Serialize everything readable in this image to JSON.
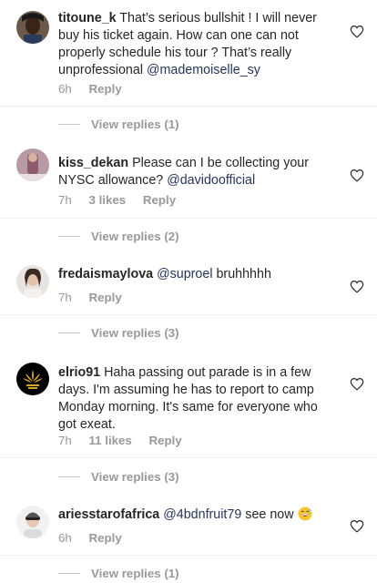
{
  "colors": {
    "text": "#262626",
    "meta": "#999999",
    "mention": "#27355a",
    "divider": "#efefef"
  },
  "icons": {
    "like": "heart-outline-icon",
    "emoji": "grinning-sweat-emoji"
  },
  "comments": [
    {
      "username": "titoune_k",
      "text": "That’s serious bullshit ! I will never buy his ticket again. How can one can not properly schedule his tour ? That’s really unprofessional",
      "mention": "@mademoiselle_sy",
      "time": "6h",
      "likes": "",
      "reply_label": "Reply",
      "view_replies": "View replies (1)"
    },
    {
      "username": "kiss_dekan",
      "text": "Please can I be collecting your NYSC allowance?",
      "mention": "@davidoofficial",
      "time": "7h",
      "likes": "3 likes",
      "reply_label": "Reply",
      "view_replies": "View replies (2)"
    },
    {
      "username": "fredaismaylova",
      "mention": "@suproel",
      "text": "bruhhhhh",
      "time": "7h",
      "likes": "",
      "reply_label": "Reply",
      "view_replies": "View replies (3)"
    },
    {
      "username": "elrio91",
      "text": "Haha passing out parade is in a few days. I'm assuming he has to report to camp Monday morning. It's same for everyone who got exeat.",
      "time": "7h",
      "likes": "11 likes",
      "reply_label": "Reply",
      "view_replies": "View replies (3)"
    },
    {
      "username": "ariesstarofafrica",
      "mention": "@4bdnfruit79",
      "text": "see now",
      "time": "6h",
      "likes": "",
      "reply_label": "Reply",
      "view_replies": "View replies (1)"
    }
  ]
}
